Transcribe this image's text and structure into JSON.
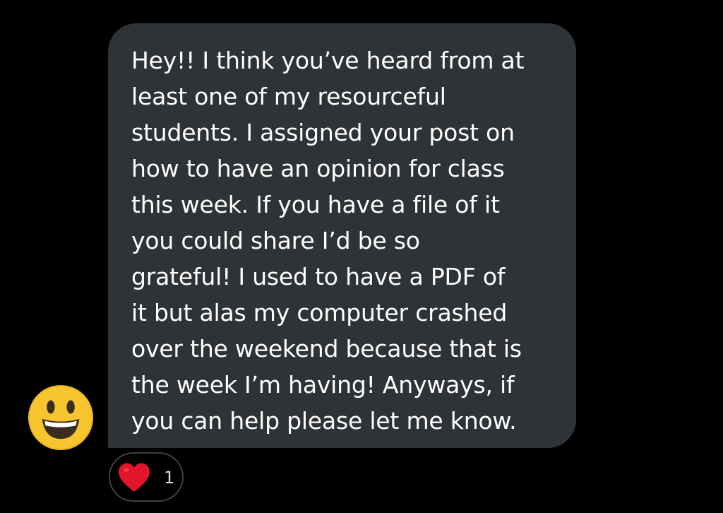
{
  "message": {
    "lines": [
      "Hey!! I think you’ve heard from at",
      "least one of my resourceful",
      "students. I assigned your post on",
      "how to have an opinion for class",
      "this week. If you have a file of it",
      "you could share I’d be so",
      "grateful! I used to have a PDF of",
      "it but alas my computer crashed",
      "over the weekend because that is",
      "the week I’m having! Anyways, if",
      "you can help please let me know."
    ]
  },
  "avatar": {
    "icon": "grinning-face-emoji"
  },
  "reaction": {
    "icon": "red-heart",
    "count": "1"
  },
  "colors": {
    "background": "#000000",
    "bubble": "#2f3336",
    "text": "#ffffff",
    "heart": "#e0162b",
    "reaction_border": "#3d4246"
  }
}
